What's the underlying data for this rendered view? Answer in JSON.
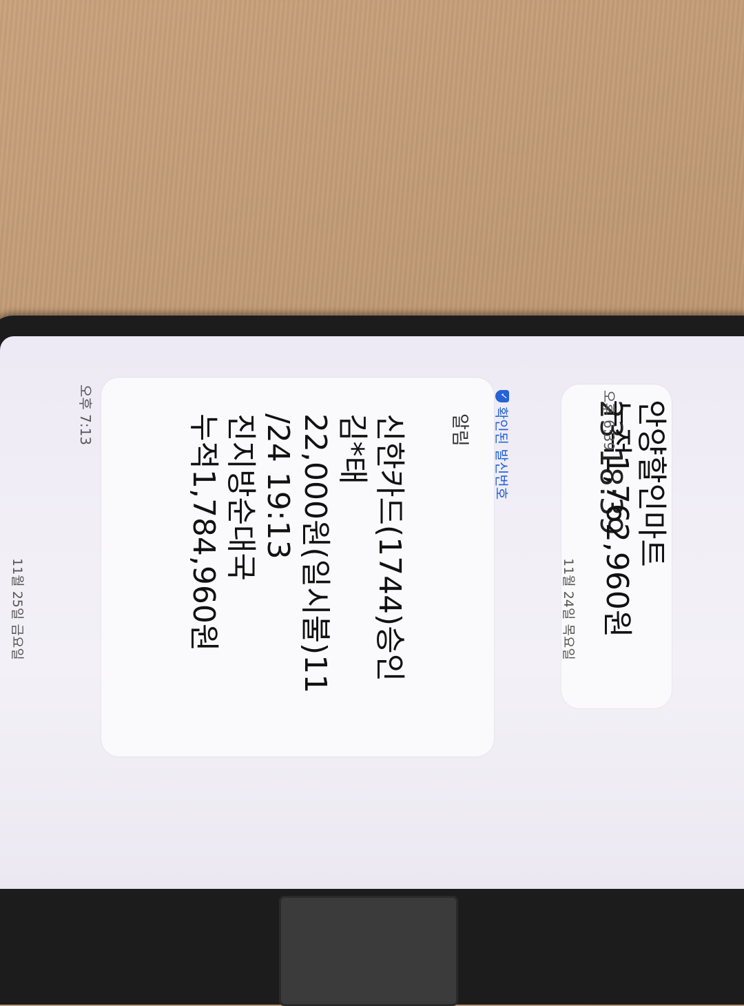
{
  "previous_message": {
    "partial_top_line": "23 18:39",
    "lines": [
      "안양할인마트",
      "누적1,762,960원"
    ],
    "time": "오후 6:39"
  },
  "date_separators": [
    "11월 24일 목요일",
    "11월 25일 금요일"
  ],
  "current_message": {
    "verified_label": "확인된 발신번호",
    "label": "알림",
    "lines": [
      "신한카드(1744)승인",
      "김*태",
      "22,000원(일시불)11",
      "/24 19:13",
      "진지방순대국",
      "누적1,784,960원"
    ],
    "time": "오후 7:13"
  },
  "colors": {
    "verified": "#2563d6",
    "screen": "#f0edf5",
    "bubble": "#fafafc",
    "desk": "#c29a75"
  }
}
